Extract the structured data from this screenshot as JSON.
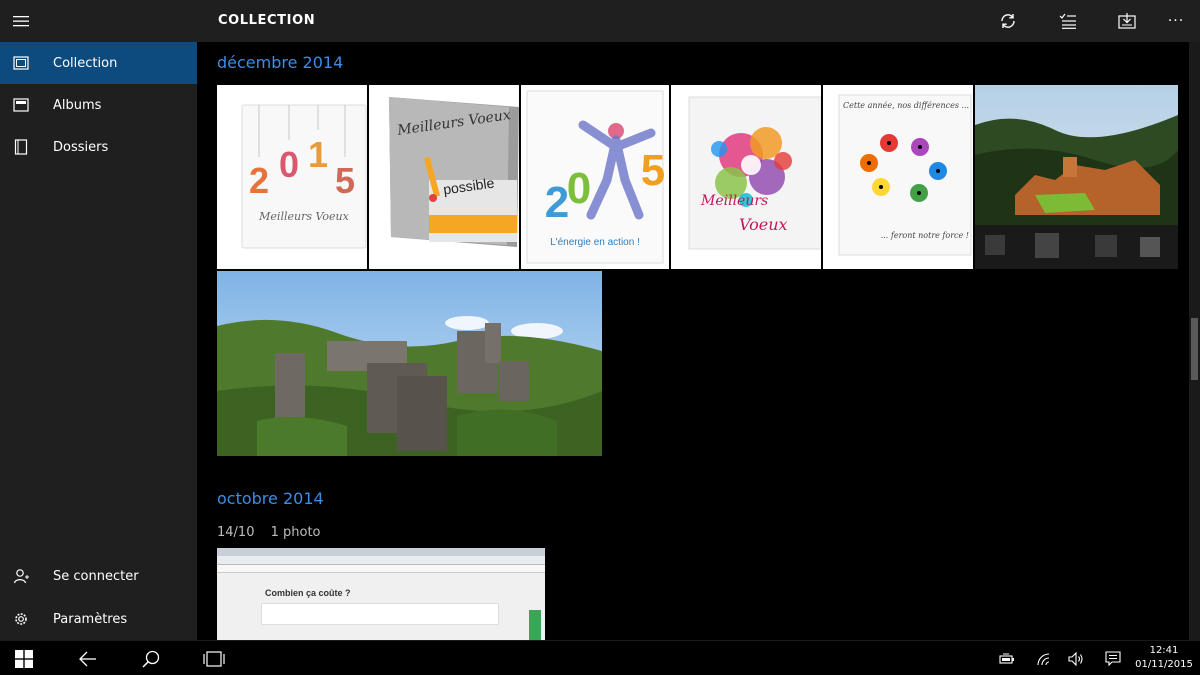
{
  "header": {
    "title": "COLLECTION",
    "more_label": "···"
  },
  "sidebar": {
    "items": [
      {
        "label": "Collection",
        "icon": "photo-collection-icon",
        "active": true
      },
      {
        "label": "Albums",
        "icon": "album-icon",
        "active": false
      },
      {
        "label": "Dossiers",
        "icon": "folder-icon",
        "active": false
      }
    ],
    "bottom_items": [
      {
        "label": "Se connecter",
        "icon": "person-icon"
      },
      {
        "label": "Paramètres",
        "icon": "gear-icon"
      }
    ]
  },
  "sections": [
    {
      "title": "décembre 2014"
    },
    {
      "title": "octobre 2014",
      "date": "14/10",
      "count": "1 photo"
    }
  ],
  "cards": {
    "card1_text": "Meilleurs Voeux",
    "card2_title": "Meilleurs Voeux",
    "card2_word": "possible",
    "card3_text": "L'énergie en action !",
    "card4_line1": "Meilleurs",
    "card4_line2": "Voeux",
    "card5_top": "Cette année, nos différences ...",
    "card5_bottom": "... feront notre force !",
    "web_heading": "Combien ça coûte ?"
  },
  "taskbar": {
    "time": "12:41",
    "date": "01/11/2015"
  },
  "colors": {
    "accent": "#3a8ee6",
    "active_nav": "#0d4a7d",
    "chrome": "#1f1f1f"
  }
}
